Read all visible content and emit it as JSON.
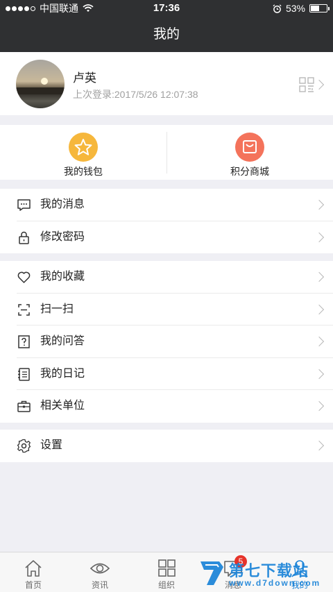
{
  "status_bar": {
    "carrier": "中国联通",
    "time": "17:36",
    "battery": "53%",
    "battery_level": 0.53
  },
  "header": {
    "title": "我的"
  },
  "profile": {
    "name": "卢英",
    "last_login": "上次登录:2017/5/26 12:07:38"
  },
  "shortcuts": [
    {
      "label": "我的钱包",
      "icon": "star-icon",
      "color": "#f6b73c"
    },
    {
      "label": "积分商城",
      "icon": "shopping-bag-icon",
      "color": "#f4735b"
    }
  ],
  "menu_groups": [
    [
      {
        "label": "我的消息",
        "icon": "message-icon"
      },
      {
        "label": "修改密码",
        "icon": "lock-icon"
      }
    ],
    [
      {
        "label": "我的收藏",
        "icon": "heart-icon"
      },
      {
        "label": "扫一扫",
        "icon": "scan-icon"
      },
      {
        "label": "我的问答",
        "icon": "question-icon"
      },
      {
        "label": "我的日记",
        "icon": "diary-icon"
      },
      {
        "label": "相关单位",
        "icon": "briefcase-icon"
      }
    ],
    [
      {
        "label": "设置",
        "icon": "gear-icon"
      }
    ]
  ],
  "tabbar": {
    "items": [
      {
        "label": "首页",
        "icon": "home-icon"
      },
      {
        "label": "资讯",
        "icon": "eye-icon"
      },
      {
        "label": "组织",
        "icon": "grid-icon"
      },
      {
        "label": "消息",
        "icon": "message-icon",
        "badge": "5"
      },
      {
        "label": "我的",
        "icon": "person-icon"
      }
    ]
  },
  "watermark": {
    "text": "第七下载站",
    "url": "www.d7down.com"
  }
}
